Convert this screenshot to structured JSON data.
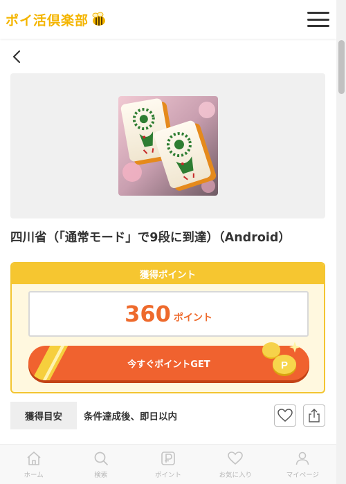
{
  "header": {
    "logo_text": "ポイ活倶楽部",
    "logo_icon": "bee-icon",
    "menu_icon": "hamburger-icon"
  },
  "nav": {
    "back_icon": "chevron-left-icon"
  },
  "campaign": {
    "title": "四川省（「通常モード」で9段に到達）（Android）",
    "image_icon": "mahjong-tiles-image"
  },
  "points": {
    "header": "獲得ポイント",
    "value": "360",
    "unit": "ポイント",
    "get_button": "今すぐポイントGET"
  },
  "info": {
    "label": "獲得目安",
    "value": "条件達成後、即日以内"
  },
  "actions": {
    "favorite_icon": "heart-icon",
    "share_icon": "share-icon"
  },
  "bottom_nav": [
    {
      "label": "ホーム",
      "icon": "home-icon"
    },
    {
      "label": "検索",
      "icon": "search-icon"
    },
    {
      "label": "ポイント",
      "icon": "point-icon"
    },
    {
      "label": "お気に入り",
      "icon": "heart-icon"
    },
    {
      "label": "マイページ",
      "icon": "user-icon"
    }
  ],
  "colors": {
    "brand_yellow": "#f4b500",
    "orange": "#f0622f",
    "points_text": "#ee6a2c",
    "box_border": "#f3c531"
  }
}
